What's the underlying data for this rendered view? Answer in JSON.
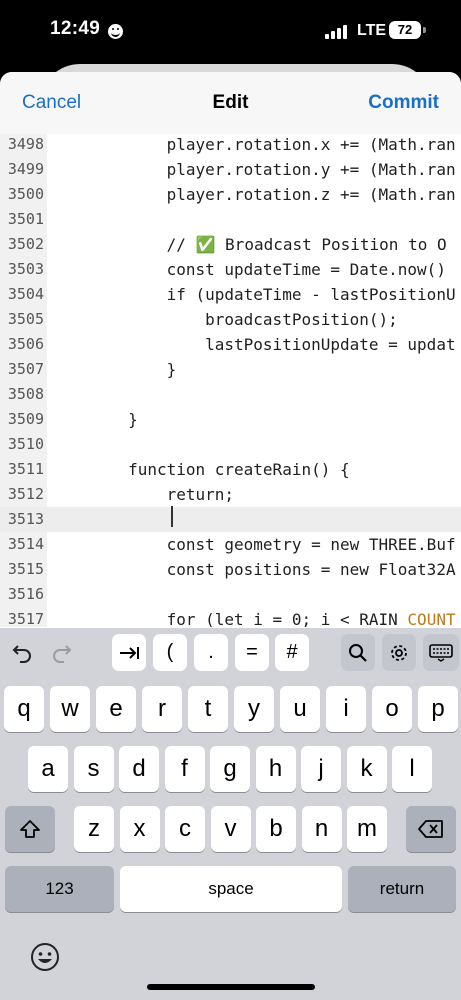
{
  "status_bar": {
    "time": "12:49",
    "network": "LTE",
    "battery": "72"
  },
  "nav": {
    "cancel": "Cancel",
    "title": "Edit",
    "commit": "Commit"
  },
  "editor": {
    "lines": [
      {
        "num": "3498",
        "pre": "            player.rotation.x += (Math.ran",
        "hl": "",
        "post": ""
      },
      {
        "num": "3499",
        "pre": "            player.rotation.y += (Math.ran",
        "hl": "",
        "post": ""
      },
      {
        "num": "3500",
        "pre": "            player.rotation.z += (Math.ran",
        "hl": "",
        "post": ""
      },
      {
        "num": "3501",
        "pre": "",
        "hl": "",
        "post": ""
      },
      {
        "num": "3502",
        "pre": "            // ✅ Broadcast Position to O",
        "hl": "",
        "post": ""
      },
      {
        "num": "3503",
        "pre": "            const updateTime = Date.now()",
        "hl": "",
        "post": ""
      },
      {
        "num": "3504",
        "pre": "            if (updateTime - lastPositionU",
        "hl": "",
        "post": ""
      },
      {
        "num": "3505",
        "pre": "                broadcastPosition();",
        "hl": "",
        "post": ""
      },
      {
        "num": "3506",
        "pre": "                lastPositionUpdate = updat",
        "hl": "",
        "post": ""
      },
      {
        "num": "3507",
        "pre": "            }",
        "hl": "",
        "post": ""
      },
      {
        "num": "3508",
        "pre": "",
        "hl": "",
        "post": ""
      },
      {
        "num": "3509",
        "pre": "        }",
        "hl": "",
        "post": ""
      },
      {
        "num": "3510",
        "pre": "",
        "hl": "",
        "post": ""
      },
      {
        "num": "3511",
        "pre": "        function createRain() {",
        "hl": "",
        "post": ""
      },
      {
        "num": "3512",
        "pre": "            return;",
        "hl": "",
        "post": ""
      },
      {
        "num": "3513",
        "pre": "",
        "hl": "",
        "post": ""
      },
      {
        "num": "3514",
        "pre": "            const geometry = new THREE.Buf",
        "hl": "",
        "post": ""
      },
      {
        "num": "3515",
        "pre": "            const positions = new Float32A",
        "hl": "",
        "post": ""
      },
      {
        "num": "3516",
        "pre": "",
        "hl": "",
        "post": ""
      },
      {
        "num": "3517",
        "pre": "            for (let i = 0; i < RAIN_",
        "hl": "COUNT",
        "post": ""
      }
    ]
  },
  "keyboard": {
    "accessory_keys": [
      "(",
      ".",
      "=",
      "#"
    ],
    "row1": [
      "q",
      "w",
      "e",
      "r",
      "t",
      "y",
      "u",
      "i",
      "o",
      "p"
    ],
    "row2": [
      "a",
      "s",
      "d",
      "f",
      "g",
      "h",
      "j",
      "k",
      "l"
    ],
    "row3": [
      "z",
      "x",
      "c",
      "v",
      "b",
      "n",
      "m"
    ],
    "numbers_label": "123",
    "space_label": "space",
    "return_label": "return"
  }
}
